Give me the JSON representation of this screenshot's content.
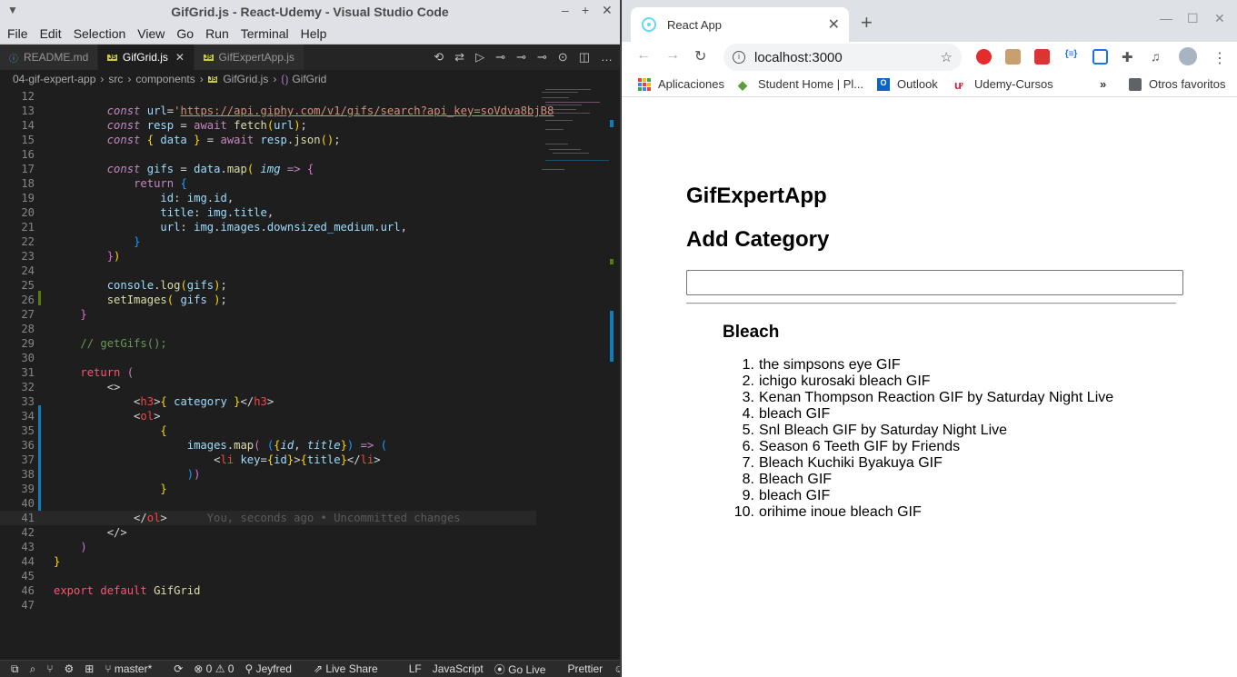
{
  "vscode": {
    "title": "GifGrid.js - React-Udemy - Visual Studio Code",
    "menu": [
      "File",
      "Edit",
      "Selection",
      "View",
      "Go",
      "Run",
      "Terminal",
      "Help"
    ],
    "tabs": [
      {
        "label": "README.md",
        "icon": "info-icon",
        "active": false
      },
      {
        "label": "GifGrid.js",
        "icon": "js-icon",
        "active": true
      },
      {
        "label": "GifExpertApp.js",
        "icon": "js-icon",
        "active": false
      }
    ],
    "breadcrumb": [
      "04-gif-expert-app",
      "src",
      "components",
      "GifGrid.js",
      "GifGrid"
    ],
    "status": {
      "branch": "master*",
      "problems": "⊗ 0 ⚠ 0",
      "user": "Jeyfred",
      "liveshare": "Live Share",
      "eol": "LF",
      "language": "JavaScript",
      "golive": "Go Live",
      "prettier": "Prettier"
    },
    "blame": "You, seconds ago • Uncommitted changes",
    "line_numbers": [
      "12",
      "13",
      "14",
      "15",
      "16",
      "17",
      "18",
      "19",
      "20",
      "21",
      "22",
      "23",
      "24",
      "25",
      "26",
      "27",
      "28",
      "29",
      "30",
      "31",
      "32",
      "33",
      "34",
      "35",
      "36",
      "37",
      "38",
      "39",
      "40",
      "41",
      "42",
      "43",
      "44",
      "45",
      "46",
      "47"
    ]
  },
  "chrome": {
    "tab_title": "React App",
    "url": "localhost:3000",
    "bookmarks": [
      "Aplicaciones",
      "Student Home | Pl...",
      "Outlook",
      "Udemy-Cursos",
      "Otros favoritos"
    ],
    "page": {
      "h1": "GifExpertApp",
      "h2": "Add Category",
      "input_value": "",
      "category": "Bleach",
      "gifs": [
        "the simpsons eye GIF",
        "ichigo kurosaki bleach GIF",
        "Kenan Thompson Reaction GIF by Saturday Night Live",
        "bleach GIF",
        "Snl Bleach GIF by Saturday Night Live",
        "Season 6 Teeth GIF by Friends",
        "Bleach Kuchiki Byakuya GIF",
        "Bleach GIF",
        "bleach GIF",
        "orihime inoue bleach GIF"
      ]
    }
  },
  "colors": {
    "vscode_bg": "#1e1e1e",
    "git_modified": "#0c7dbd",
    "git_added": "#587c0c",
    "chrome_tabstrip": "#dee1e6"
  }
}
